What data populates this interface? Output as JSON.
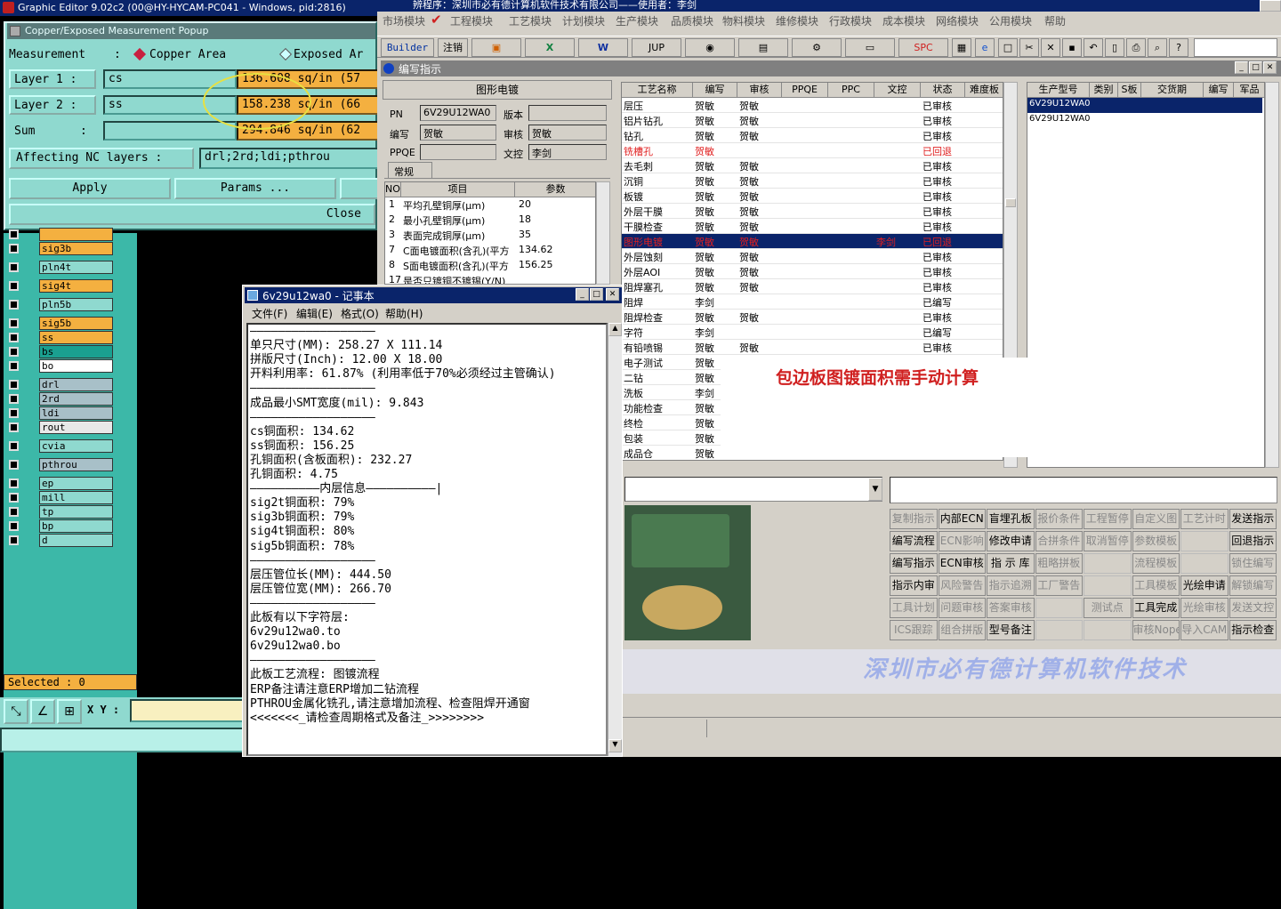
{
  "ge": {
    "title": "Graphic Editor 9.02c2 (00@HY-HYCAM-PC041 - Windows, pid:2816)",
    "popup_title": "Copper/Exposed Measurement Popup",
    "measurement_label": "Measurement",
    "colon": ":",
    "opt_copper": "Copper Area",
    "opt_exposed": "Exposed Ar",
    "layer1_label": "Layer  1 :",
    "layer1_value": "cs",
    "layer1_area": "136.608 sq/in (57",
    "layer2_label": "Layer  2 :",
    "layer2_value": "ss",
    "layer2_area": "158.238 sq/in (66",
    "sum_label": "Sum",
    "sum_area": "294.846 sq/in (62",
    "affecting_label": "Affecting NC layers :",
    "affecting_value": "drl;2rd;ldi;pthrou",
    "apply": "Apply",
    "params": "Params ...",
    "close": "Close",
    "layers": [
      {
        "name": "",
        "color": "#f4b040"
      },
      {
        "name": "sig3b",
        "color": "#f4b040"
      },
      {
        "name": "pln4t",
        "color": "#8fd9cf"
      },
      {
        "name": "sig4t",
        "color": "#f4b040"
      },
      {
        "name": "pln5b",
        "color": "#8fd9cf"
      },
      {
        "name": "sig5b",
        "color": "#f4b040"
      },
      {
        "name": "ss",
        "color": "#f4b040"
      },
      {
        "name": "bs",
        "color": "#1aa090"
      },
      {
        "name": "bo",
        "color": "#ffffff"
      },
      {
        "name": "drl",
        "color": "#a8c0c8"
      },
      {
        "name": "2rd",
        "color": "#a8c0c8"
      },
      {
        "name": "ldi",
        "color": "#a8c0c8"
      },
      {
        "name": "rout",
        "color": "#e8e8e8"
      },
      {
        "name": "cvia",
        "color": "#8fd9cf"
      },
      {
        "name": "pthrou",
        "color": "#a8c0c8"
      },
      {
        "name": "ep",
        "color": "#8fd9cf"
      },
      {
        "name": "mill",
        "color": "#8fd9cf"
      },
      {
        "name": "tp",
        "color": "#8fd9cf"
      },
      {
        "name": "bp",
        "color": "#8fd9cf"
      },
      {
        "name": "d",
        "color": "#8fd9cf"
      }
    ],
    "selected": "Selected : 0",
    "xy_label": "X Y :"
  },
  "erp": {
    "title": "辨程序：深圳市必有德计算机软件技术有限公司——使用者：李剑",
    "menus": [
      "市场模块",
      "工程模块",
      "工艺模块",
      "计划模块",
      "生产模块",
      "品质模块",
      "物料模块",
      "维修模块",
      "行政模块",
      "成本模块",
      "网络模块",
      "公用模块",
      "帮助"
    ],
    "toolbar_builder": "Builder",
    "toolbar_cancel": "注销",
    "toolbar_jup": "JUP",
    "toolbar_spc": "SPC",
    "inner_title": "编写指示",
    "form_header": "图形电镀",
    "pn_label": "PN",
    "pn_value": "6V29U12WA0",
    "version_label": "版本",
    "write_label": "编写",
    "write_value": "贺敏",
    "audit_label": "审核",
    "audit_value": "贺敏",
    "ppqe_label": "PPQE",
    "doc_audit_label": "文控",
    "doc_audit_value": "李剑",
    "tab_general": "常规",
    "param_headers": [
      "NO",
      "项目",
      "参数"
    ],
    "params": [
      {
        "no": "1",
        "item": "平均孔壁铜厚(μm)",
        "val": "20"
      },
      {
        "no": "2",
        "item": "最小孔壁铜厚(μm)",
        "val": "18"
      },
      {
        "no": "3",
        "item": "表面完成铜厚(μm)",
        "val": "35"
      },
      {
        "no": "7",
        "item": "C面电镀面积(含孔)(平方",
        "val": "134.62"
      },
      {
        "no": "8",
        "item": "S面电镀面积(含孔)(平方",
        "val": "156.25"
      },
      {
        "no": "17",
        "item": "是否只镀铜不镀锡(Y/N)",
        "val": ""
      }
    ],
    "proc_headers": [
      "工艺名称",
      "编写",
      "审核",
      "PPQE",
      "PPC",
      "文控",
      "状态",
      "难度板"
    ],
    "procs": [
      {
        "name": "层压",
        "w": "贺敏",
        "a": "贺敏",
        "d": "",
        "s": "已审核",
        "red": false
      },
      {
        "name": "铝片钻孔",
        "w": "贺敏",
        "a": "贺敏",
        "d": "",
        "s": "已审核",
        "red": false
      },
      {
        "name": "钻孔",
        "w": "贺敏",
        "a": "贺敏",
        "d": "",
        "s": "已审核",
        "red": false
      },
      {
        "name": "铣槽孔",
        "w": "贺敏",
        "a": "",
        "d": "",
        "s": "已回退",
        "red": true
      },
      {
        "name": "去毛刺",
        "w": "贺敏",
        "a": "贺敏",
        "d": "",
        "s": "已审核",
        "red": false
      },
      {
        "name": "沉铜",
        "w": "贺敏",
        "a": "贺敏",
        "d": "",
        "s": "已审核",
        "red": false
      },
      {
        "name": "板镀",
        "w": "贺敏",
        "a": "贺敏",
        "d": "",
        "s": "已审核",
        "red": false
      },
      {
        "name": "外层干膜",
        "w": "贺敏",
        "a": "贺敏",
        "d": "",
        "s": "已审核",
        "red": false
      },
      {
        "name": "干膜检查",
        "w": "贺敏",
        "a": "贺敏",
        "d": "",
        "s": "已审核",
        "red": false
      },
      {
        "name": "图形电镀",
        "w": "贺敏",
        "a": "贺敏",
        "d": "李剑",
        "s": "已回退",
        "red": true,
        "sel": true
      },
      {
        "name": "外层蚀刻",
        "w": "贺敏",
        "a": "贺敏",
        "d": "",
        "s": "已审核",
        "red": false
      },
      {
        "name": "外层AOI",
        "w": "贺敏",
        "a": "贺敏",
        "d": "",
        "s": "已审核",
        "red": false
      },
      {
        "name": "阻焊塞孔",
        "w": "贺敏",
        "a": "贺敏",
        "d": "",
        "s": "已审核",
        "red": false
      },
      {
        "name": "阻焊",
        "w": "李剑",
        "a": "",
        "d": "",
        "s": "已编写",
        "red": false
      },
      {
        "name": "阻焊检查",
        "w": "贺敏",
        "a": "贺敏",
        "d": "",
        "s": "已审核",
        "red": false
      },
      {
        "name": "字符",
        "w": "李剑",
        "a": "",
        "d": "",
        "s": "已编写",
        "red": false
      },
      {
        "name": "有铅喷锡",
        "w": "贺敏",
        "a": "贺敏",
        "d": "",
        "s": "已审核",
        "red": false
      },
      {
        "name": "电子测试",
        "w": "贺敏",
        "a": "",
        "d": "",
        "s": "",
        "red": false
      },
      {
        "name": "二钻",
        "w": "贺敏",
        "a": "",
        "d": "",
        "s": "",
        "red": false
      },
      {
        "name": "洗板",
        "w": "李剑",
        "a": "",
        "d": "",
        "s": "",
        "red": false
      },
      {
        "name": "功能检查",
        "w": "贺敏",
        "a": "",
        "d": "",
        "s": "",
        "red": false
      },
      {
        "name": "终检",
        "w": "贺敏",
        "a": "",
        "d": "",
        "s": "",
        "red": false
      },
      {
        "name": "包装",
        "w": "贺敏",
        "a": "",
        "d": "",
        "s": "",
        "red": false
      },
      {
        "name": "成品仓",
        "w": "贺敏",
        "a": "",
        "d": "",
        "s": "",
        "red": false
      }
    ],
    "model_headers": [
      "生产型号",
      "类别",
      "S板",
      "交货期",
      "编写",
      "军品"
    ],
    "models": [
      "6V29U12WA0",
      "6V29U12WA0"
    ],
    "callout": "包边板图镀面积需手动计算",
    "buttons": [
      [
        "复制指示",
        "内部ECN",
        "盲埋孔板",
        "报价条件",
        "工程暂停",
        "自定义图",
        "工艺计时",
        "发送指示"
      ],
      [
        "编写流程",
        "ECN影响",
        "修改申请",
        "合拼条件",
        "取消暂停",
        "参数模板",
        "",
        "回退指示"
      ],
      [
        "编写指示",
        "ECN审核",
        "指 示 库",
        "粗略拼板",
        "",
        "流程模板",
        "",
        "锁住编写"
      ],
      [
        "指示内审",
        "风险警告",
        "指示追溯",
        "工厂警告",
        "",
        "工具模板",
        "光绘申请",
        "解锁编写"
      ],
      [
        "工具计划",
        "问题审核",
        "答案审核",
        "",
        "测试点",
        "工具完成",
        "光绘审核",
        "发送文控"
      ],
      [
        "ICS跟踪",
        "组合拼版",
        "型号备注",
        "",
        "",
        "审核Nope",
        "导入CAM",
        "指示检查"
      ]
    ],
    "banner": "深圳市必有德计算机软件技术"
  },
  "notepad": {
    "title": "6v29u12wa0 - 记事本",
    "menus": [
      "文件(F)",
      "编辑(E)",
      "格式(O)",
      "帮助(H)"
    ],
    "lines": [
      "——————————————————",
      "单只尺寸(MM): 258.27 X 111.14",
      "拼版尺寸(Inch): 12.00 X 18.00",
      "开料利用率: 61.87% (利用率低于70%必须经过主管确认)",
      "——————————————————",
      "成品最小SMT宽度(mil): 9.843",
      "——————————————————",
      "cs铜面积: 134.62",
      "ss铜面积: 156.25",
      "孔铜面积(含板面积): 232.27",
      "孔铜面积: 4.75",
      "——————————内层信息——————————|",
      "sig2t铜面积: 79%",
      "sig3b铜面积: 79%",
      "sig4t铜面积: 80%",
      "sig5b铜面积: 78%",
      "——————————————————",
      "层压管位长(MM): 444.50",
      "层压管位宽(MM): 266.70",
      "——————————————————",
      "此板有以下字符层:",
      "6v29u12wa0.to",
      "6v29u12wa0.bo",
      "——————————————————",
      "此板工艺流程: 图镀流程",
      "ERP备注请注意ERP增加二钻流程",
      "PTHROU金属化铣孔,请注意增加流程、检查阻焊开通窗",
      "<<<<<<<_请检查周期格式及备注_>>>>>>>>"
    ]
  }
}
